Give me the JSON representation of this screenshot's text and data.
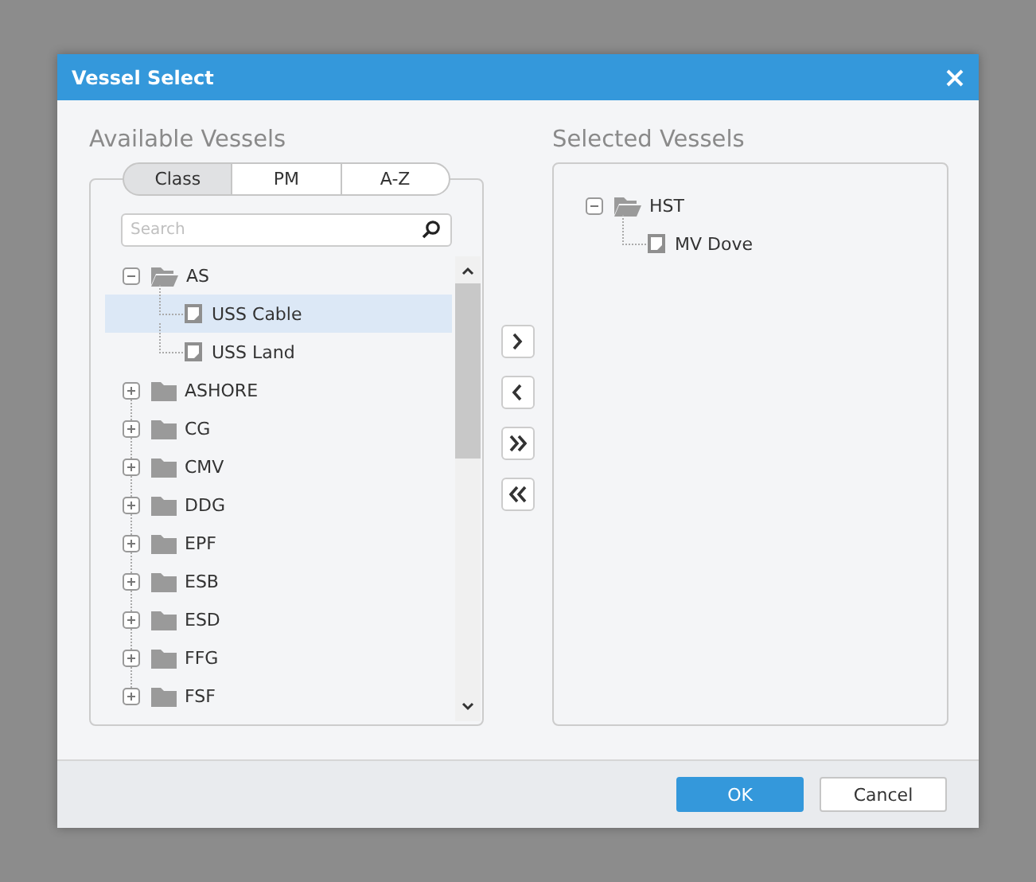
{
  "window": {
    "title": "Vessel Select"
  },
  "available": {
    "heading": "Available Vessels",
    "tabs": [
      {
        "label": "Class",
        "selected": true
      },
      {
        "label": "PM",
        "selected": false
      },
      {
        "label": "A-Z",
        "selected": false
      }
    ],
    "search": {
      "placeholder": "Search"
    },
    "tree": [
      {
        "label": "AS",
        "expanded": true,
        "selected": false,
        "children": [
          {
            "label": "USS Cable",
            "selected": true
          },
          {
            "label": "USS Land",
            "selected": false
          }
        ]
      },
      {
        "label": "ASHORE",
        "expanded": false,
        "selected": false
      },
      {
        "label": "CG",
        "expanded": false,
        "selected": false
      },
      {
        "label": "CMV",
        "expanded": false,
        "selected": false
      },
      {
        "label": "DDG",
        "expanded": false,
        "selected": false
      },
      {
        "label": "EPF",
        "expanded": false,
        "selected": false
      },
      {
        "label": "ESB",
        "expanded": false,
        "selected": false
      },
      {
        "label": "ESD",
        "expanded": false,
        "selected": false
      },
      {
        "label": "FFG",
        "expanded": false,
        "selected": false
      },
      {
        "label": "FSF",
        "expanded": false,
        "selected": false
      }
    ]
  },
  "selected_vessels": {
    "heading": "Selected Vessels",
    "tree": [
      {
        "label": "HST",
        "expanded": true,
        "selected": false,
        "children": [
          {
            "label": "MV Dove",
            "selected": false
          }
        ]
      }
    ]
  },
  "buttons": [
    {
      "label": "OK",
      "kind": "primary"
    },
    {
      "label": "Cancel",
      "kind": "secondary"
    }
  ]
}
